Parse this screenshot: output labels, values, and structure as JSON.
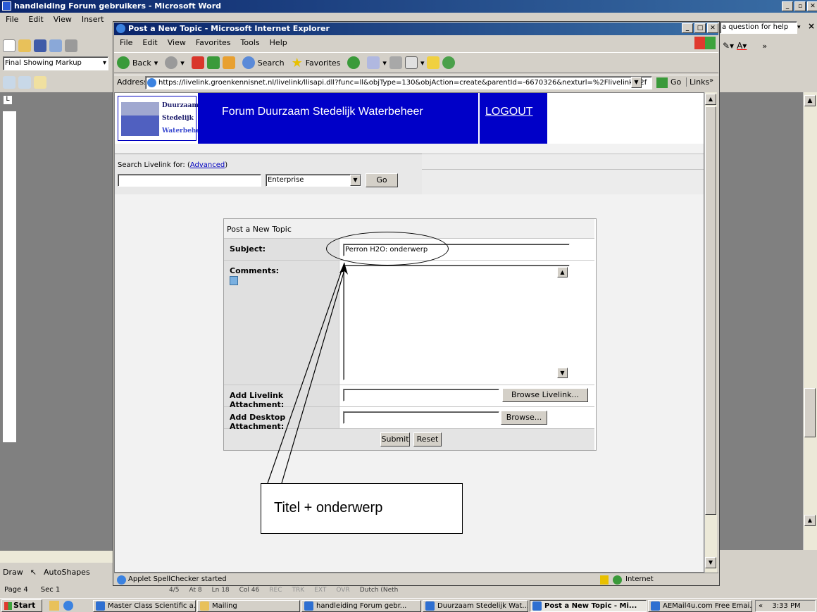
{
  "word": {
    "title": "handleiding Forum gebruikers - Microsoft Word",
    "menu": [
      "File",
      "Edit",
      "View",
      "Insert"
    ],
    "help_placeholder": "a question for help",
    "markup_select": "Final Showing Markup",
    "draw_label": "Draw",
    "autoshapes_label": "AutoShapes",
    "status": {
      "page": "Page 4",
      "sec": "Sec 1",
      "pos": "4/5",
      "at": "At 8",
      "ln": "Ln 18",
      "col": "Col 46",
      "rec": "REC",
      "trk": "TRK",
      "ext": "EXT",
      "ovr": "OVR",
      "lang": "Dutch (Neth"
    }
  },
  "ie": {
    "title": "Post a New Topic - Microsoft Internet Explorer",
    "menu": [
      "File",
      "Edit",
      "View",
      "Favorites",
      "Tools",
      "Help"
    ],
    "back_label": "Back",
    "search_label": "Search",
    "favorites_label": "Favorites",
    "address_label": "Address",
    "address_url": "https://livelink.groenkennisnet.nl/livelink/llisapi.dll?func=ll&objType=130&objAction=create&parentId=-6670326&nexturl=%2Flivelink%2f",
    "go_label": "Go",
    "links_label": "Links",
    "status_text": "Applet SpellChecker started",
    "zone_label": "Internet"
  },
  "page": {
    "logo_lines": [
      "Duurzaam",
      "Stedelijk",
      "Waterbeheer"
    ],
    "forum_title": "Forum Duurzaam Stedelijk Waterbeheer",
    "logout_label": "LOGOUT",
    "search_label": "Search Livelink for:",
    "advanced_label": "Advanced",
    "search_scope": "Enterprise",
    "search_go": "Go",
    "form": {
      "heading": "Post a New Topic",
      "subject_label": "Subject:",
      "subject_value": "Perron H2O: onderwerp",
      "comments_label": "Comments:",
      "livelink_attach_label": "Add Livelink Attachment:",
      "browse_livelink_label": "Browse Livelink...",
      "desktop_attach_label": "Add Desktop Attachment:",
      "browse_label": "Browse...",
      "submit_label": "Submit",
      "reset_label": "Reset"
    },
    "annotation": "Titel + onderwerp"
  },
  "taskbar": {
    "start_label": "Start",
    "items": [
      "Master Class Scientific a...",
      "Mailing",
      "handleiding Forum gebr...",
      "Duurzaam Stedelijk Wat...",
      "Post a New Topic - Mi...",
      "AEMail4u.com Free Emai..."
    ],
    "time": "3:33 PM"
  }
}
